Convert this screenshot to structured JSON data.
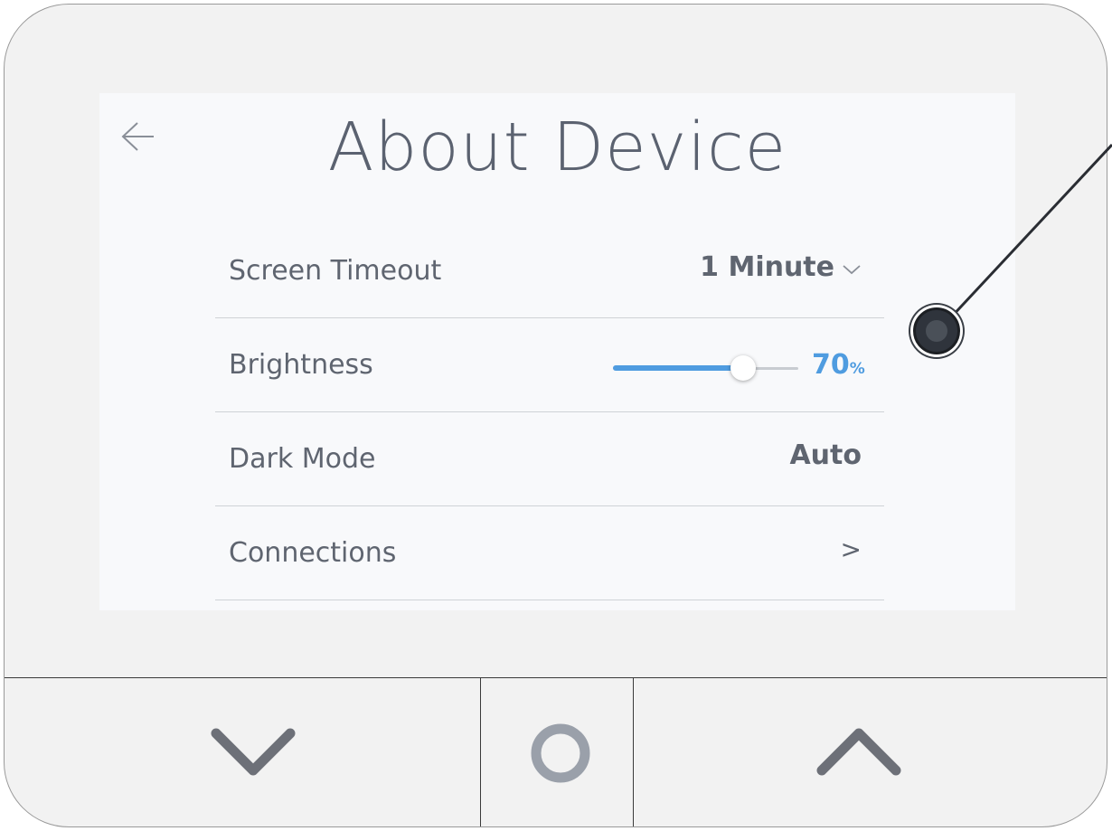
{
  "header": {
    "title": "About Device",
    "back_icon": "back-arrow-icon"
  },
  "settings": [
    {
      "label": "Screen Timeout",
      "value": "1 Minute",
      "control": "dropdown"
    },
    {
      "label": "Brightness",
      "value": "70",
      "unit": "%",
      "control": "slider",
      "level_percent": 70
    },
    {
      "label": "Dark Mode",
      "value": "Auto",
      "control": "value"
    },
    {
      "label": "Connections",
      "value": ">",
      "control": "link"
    }
  ],
  "hardware_buttons": [
    {
      "name": "down",
      "icon": "chevron-down-icon"
    },
    {
      "name": "home",
      "icon": "circle-icon"
    },
    {
      "name": "up",
      "icon": "chevron-up-icon"
    }
  ],
  "colors": {
    "accent": "#4f9ce0",
    "text": "#5f6570",
    "title": "#5b6270",
    "screen_bg": "#f8f9fb",
    "device_bg": "#f2f2f2",
    "button_icon": "#6d7078",
    "home_icon": "#9aa0aa"
  }
}
